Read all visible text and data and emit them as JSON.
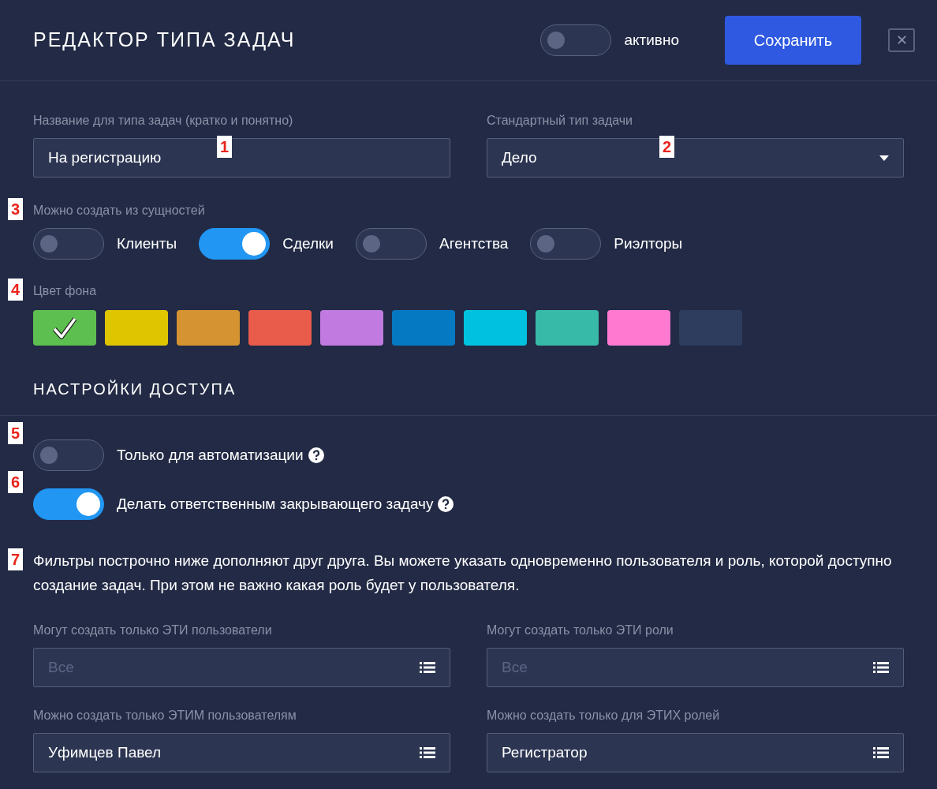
{
  "header": {
    "title": "РЕДАКТОР ТИПА ЗАДАЧ",
    "active_toggle": {
      "label": "активно",
      "on": false
    },
    "save_button": "Сохранить",
    "close_button": "✕"
  },
  "name_field": {
    "marker": "1",
    "label": "Название для типа задач (кратко и понятно)",
    "value": "На регистрацию"
  },
  "type_select": {
    "marker": "2",
    "label": "Стандартный тип задачи",
    "value": "Дело"
  },
  "entities": {
    "marker": "3",
    "label": "Можно создать из сущностей",
    "items": [
      {
        "label": "Клиенты",
        "on": false
      },
      {
        "label": "Сделки",
        "on": true
      },
      {
        "label": "Агентства",
        "on": false
      },
      {
        "label": "Риэлторы",
        "on": false
      }
    ]
  },
  "background_color": {
    "marker": "4",
    "label": "Цвет фона",
    "swatches": [
      {
        "color": "#5cbf4f",
        "selected": true
      },
      {
        "color": "#dfc400",
        "selected": false
      },
      {
        "color": "#d69331",
        "selected": false
      },
      {
        "color": "#e95b4a",
        "selected": false
      },
      {
        "color": "#c17ae0",
        "selected": false
      },
      {
        "color": "#0679c3",
        "selected": false
      },
      {
        "color": "#00c1e0",
        "selected": false
      },
      {
        "color": "#38baa8",
        "selected": false
      },
      {
        "color": "#ff79d1",
        "selected": false
      },
      {
        "color": "#2e3d5e",
        "selected": false
      }
    ]
  },
  "access_section": {
    "title": "НАСТРОЙКИ ДОСТУПА",
    "options": [
      {
        "marker": "5",
        "label": "Только для автоматизации",
        "on": false
      },
      {
        "marker": "6",
        "label": "Делать ответственным закрывающего задачу",
        "on": true
      }
    ]
  },
  "filters_note": {
    "marker": "7",
    "text": "Фильтры построчно ниже дополняют друг друга. Вы можете указать одновременно пользователя и роль, которой доступно создание задач. При этом не важно какая роль будет у пользователя."
  },
  "filter_fields": [
    {
      "label": "Могут создать только ЭТИ пользователи",
      "placeholder": "Все"
    },
    {
      "label": "Могут создать только ЭТИ роли",
      "placeholder": "Все"
    },
    {
      "label": "Можно создать только ЭТИМ пользователям",
      "value": "Уфимцев Павел"
    },
    {
      "label": "Можно создать только для ЭТИХ ролей",
      "value": "Регистратор"
    }
  ]
}
